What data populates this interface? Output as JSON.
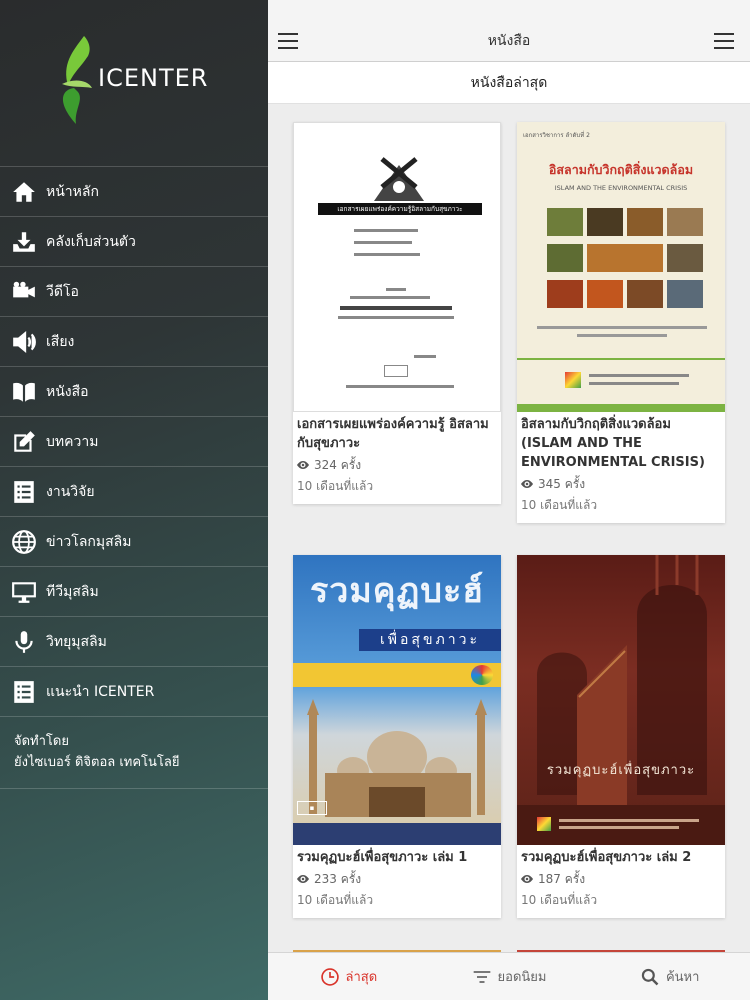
{
  "sidebar": {
    "logo_text": "ICENTER",
    "items": [
      {
        "label": "หน้าหลัก",
        "icon": "home-icon"
      },
      {
        "label": "คลังเก็บส่วนตัว",
        "icon": "download-tray-icon"
      },
      {
        "label": "วีดีโอ",
        "icon": "video-camera-icon"
      },
      {
        "label": "เสียง",
        "icon": "speaker-icon"
      },
      {
        "label": "หนังสือ",
        "icon": "book-icon"
      },
      {
        "label": "บทความ",
        "icon": "edit-note-icon"
      },
      {
        "label": "งานวิจัย",
        "icon": "list-document-icon"
      },
      {
        "label": "ข่าวโลกมุสลิม",
        "icon": "globe-icon"
      },
      {
        "label": "ทีวีมุสลิม",
        "icon": "monitor-icon"
      },
      {
        "label": "วิทยุมุสลิม",
        "icon": "microphone-icon"
      },
      {
        "label": "แนะนำ ICENTER",
        "icon": "list-document-icon"
      }
    ],
    "credit_line1": "จัดทำโดย",
    "credit_line2": "ยังไซเบอร์ ดิจิตอล เทคโนโลยี"
  },
  "header": {
    "title": "หนังสือ",
    "subtitle": "หนังสือล่าสุด"
  },
  "books": [
    {
      "title": "เอกสารเผยแพร่องค์ความรู้ อิสลามกับสุขภาวะ",
      "views": "324 ครั้ง",
      "time": "10 เดือนที่แล้ว"
    },
    {
      "title": "อิสลามกับวิกฤติสิ่งแวดล้อม (ISLAM AND THE ENVIRONMENTAL CRISIS)",
      "views": "345 ครั้ง",
      "time": "10 เดือนที่แล้ว"
    },
    {
      "title": "รวมคุฏบะฮ์เพื่อสุขภาวะ เล่ม 1",
      "views": "233 ครั้ง",
      "time": "10 เดือนที่แล้ว"
    },
    {
      "title": "รวมคุฏบะฮ์เพื่อสุขภาวะ เล่ม 2",
      "views": "187 ครั้ง",
      "time": "10 เดือนที่แล้ว"
    }
  ],
  "covers": {
    "c1_heading": "เอกสารเผยแพร่องค์ความรู้อิสลามกับสุขภาวะ",
    "c2_series": "เอกสารวิชาการ ลำดับที่ 2",
    "c2_title": "อิสลามกับวิกฤติสิ่งแวดล้อม",
    "c2_subtitle": "ISLAM AND THE ENVIRONMENTAL CRISIS",
    "c3_title": "รวมคุฏบะฮ์",
    "c3_sub": "เพื่อสุขภาวะ",
    "c4_title": "รวมคุฏบะฮ์เพื่อสุขภาวะ"
  },
  "tabs": [
    {
      "label": "ล่าสุด",
      "icon": "clock-icon",
      "active": true
    },
    {
      "label": "ยอดนิยม",
      "icon": "filter-lines-icon",
      "active": false
    },
    {
      "label": "ค้นหา",
      "icon": "search-icon",
      "active": false
    }
  ],
  "colors": {
    "accent": "#d9342b",
    "logo_green": "#5bbf2a"
  }
}
